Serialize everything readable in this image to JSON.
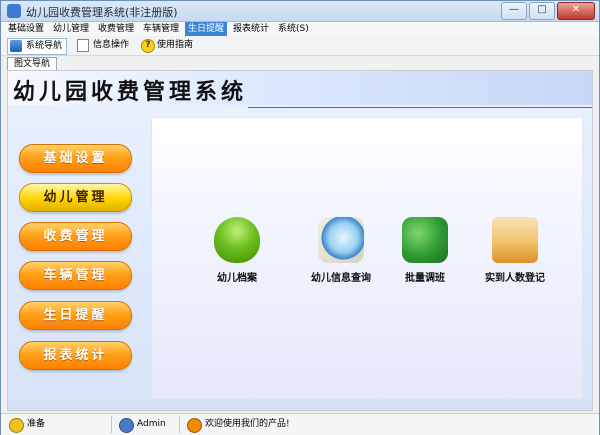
{
  "window": {
    "title": "幼儿园收费管理系统(非注册版)"
  },
  "menu": [
    "基础设置",
    "幼儿管理",
    "收费管理",
    "车辆管理",
    "生日提醒",
    "报表统计",
    "系统(S)"
  ],
  "toolbar": [
    "系统导航",
    "信息操作",
    "使用指南"
  ],
  "tab": "图文导航",
  "header": {
    "title": "幼儿园收费管理系统"
  },
  "nav": [
    "基础设置",
    "幼儿管理",
    "收费管理",
    "车辆管理",
    "生日提醒",
    "报表统计"
  ],
  "functions": [
    "幼儿档案",
    "幼儿信息查询",
    "批量调班",
    "实到人数登记"
  ],
  "status": {
    "ready": "准备",
    "user": "Admin",
    "welcome": "欢迎使用我们的产品!"
  },
  "colors": {
    "menu_active": "#3c84d6",
    "nav_orange": "#ff8a00",
    "nav_yellow": "#ffd400"
  }
}
